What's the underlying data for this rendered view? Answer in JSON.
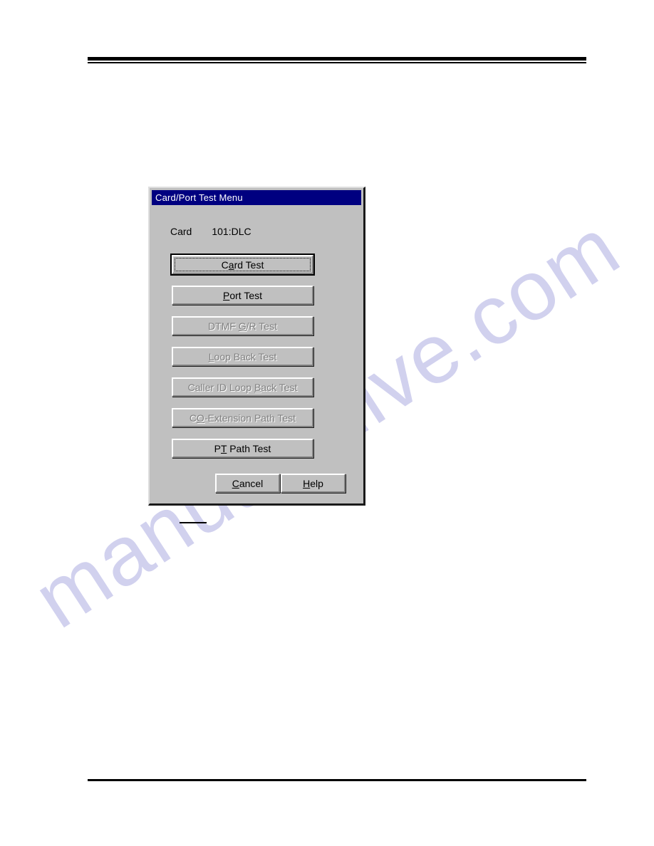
{
  "page": {
    "watermark": "manualshive.com",
    "header_rule": true,
    "footer_rule": true,
    "caption_rule": true
  },
  "dialog": {
    "title": "Card/Port Test Menu",
    "card_field": {
      "label": "Card",
      "value": "101:DLC"
    },
    "buttons": [
      {
        "id": "card-test",
        "pre": "C",
        "mnemonic": "a",
        "post": "rd Test",
        "full_label": "Card Test",
        "state": "default",
        "enabled": true
      },
      {
        "id": "port-test",
        "pre": "",
        "mnemonic": "P",
        "post": "ort Test",
        "full_label": "Port Test",
        "state": "normal",
        "enabled": true
      },
      {
        "id": "dtmf-gr-test",
        "pre": "DTMF ",
        "mnemonic": "G",
        "post": "/R Test",
        "full_label": "DTMF G/R Test",
        "state": "disabled",
        "enabled": false
      },
      {
        "id": "loop-back-test",
        "pre": "",
        "mnemonic": "L",
        "post": "oop Back Test",
        "full_label": "Loop Back Test",
        "state": "disabled",
        "enabled": false
      },
      {
        "id": "caller-id-loop-back-test",
        "pre": "Caller ID Loop ",
        "mnemonic": "B",
        "post": "ack Test",
        "full_label": "Caller ID Loop Back Test",
        "state": "disabled",
        "enabled": false
      },
      {
        "id": "co-extension-path-test",
        "pre": "C",
        "mnemonic": "O",
        "post": "-Extension Path Test",
        "full_label": "CO-Extension Path Test",
        "state": "disabled",
        "enabled": false
      },
      {
        "id": "pt-path-test",
        "pre": "P",
        "mnemonic": "T",
        "post": " Path Test",
        "full_label": "PT Path Test",
        "state": "normal",
        "enabled": true
      }
    ],
    "actions": [
      {
        "id": "cancel",
        "pre": "",
        "mnemonic": "C",
        "post": "ancel",
        "full_label": "Cancel",
        "enabled": true
      },
      {
        "id": "help",
        "pre": "",
        "mnemonic": "H",
        "post": "elp",
        "full_label": "Help",
        "enabled": true
      }
    ]
  },
  "colors": {
    "titlebar": "#000080",
    "titlebar_text": "#ffffff",
    "dialog_face": "#c0c0c0",
    "disabled_text": "#808080",
    "watermark": "#c9c9ec",
    "rule": "#000000"
  }
}
